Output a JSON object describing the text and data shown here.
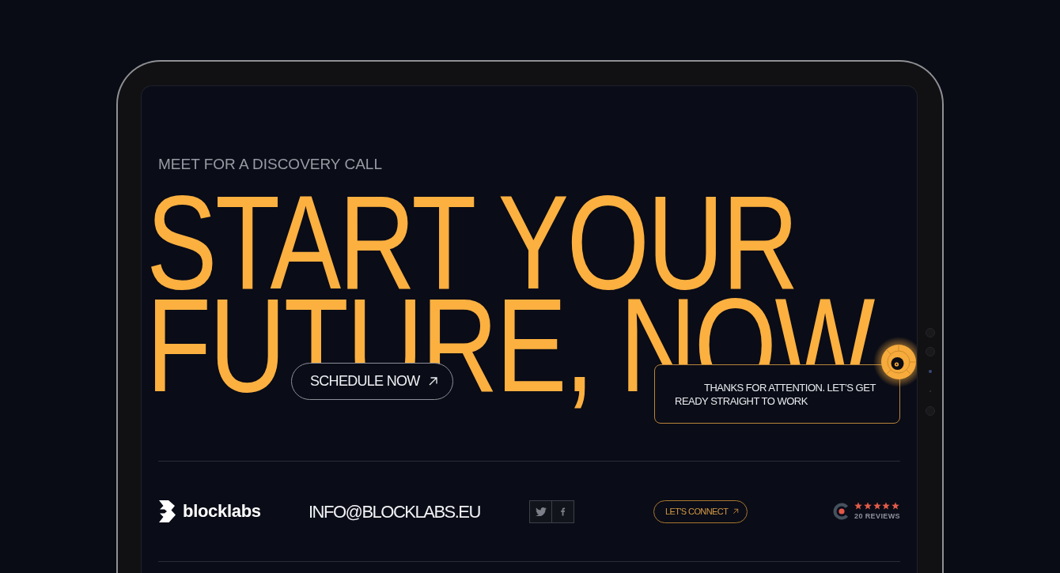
{
  "eyebrow": "MEET FOR A DISCOVERY CALL",
  "headline": {
    "lines": [
      "START YOUR",
      "FUTURE, NOW"
    ]
  },
  "schedule_button": {
    "label": "SCHEDULE NOW"
  },
  "message_card": {
    "text": "THANKS FOR ATTENTION. LET’S GET READY STRAIGHT TO WORK"
  },
  "footer": {
    "brand": "blocklabs",
    "email": "INFO@BLOCKLABS.EU",
    "social_links": [
      {
        "kind": "twitter"
      },
      {
        "kind": "facebook"
      }
    ],
    "connect_button": {
      "label": "LET'S CONNECT"
    },
    "reviews": {
      "stars": 5,
      "label": "20 REVIEWS"
    }
  }
}
